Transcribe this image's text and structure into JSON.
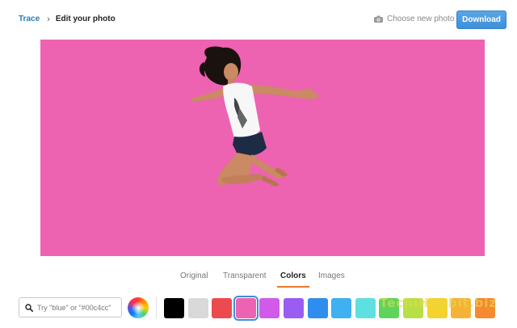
{
  "header": {
    "breadcrumb_root": "Trace",
    "breadcrumb_current": "Edit your photo",
    "choose_photo_label": "Choose new photo",
    "download_label": "Download"
  },
  "canvas": {
    "background_color": "#ee62b2",
    "subject": "jumping-woman-cutout"
  },
  "tabs": [
    {
      "label": "Original",
      "active": false
    },
    {
      "label": "Transparent",
      "active": false
    },
    {
      "label": "Colors",
      "active": true
    },
    {
      "label": "Images",
      "active": false
    }
  ],
  "search": {
    "placeholder": "Try \"blue\" or \"#00c4cc\"",
    "value": ""
  },
  "swatches": [
    {
      "color": "#000000",
      "selected": false
    },
    {
      "color": "#d9d9d9",
      "selected": false
    },
    {
      "color": "#eb4a4f",
      "selected": false
    },
    {
      "color": "#ee62b2",
      "selected": true
    },
    {
      "color": "#d25ae8",
      "selected": false
    },
    {
      "color": "#9a5cf2",
      "selected": false
    },
    {
      "color": "#2f8eed",
      "selected": false
    },
    {
      "color": "#3fb0f0",
      "selected": false
    },
    {
      "color": "#5fe0e0",
      "selected": false
    },
    {
      "color": "#5fd45a",
      "selected": false
    },
    {
      "color": "#b7e044",
      "selected": false
    },
    {
      "color": "#f5d22c",
      "selected": false
    },
    {
      "color": "#f5b236",
      "selected": false
    },
    {
      "color": "#f58a30",
      "selected": false
    }
  ],
  "watermark": "TechiHobbit.biz"
}
